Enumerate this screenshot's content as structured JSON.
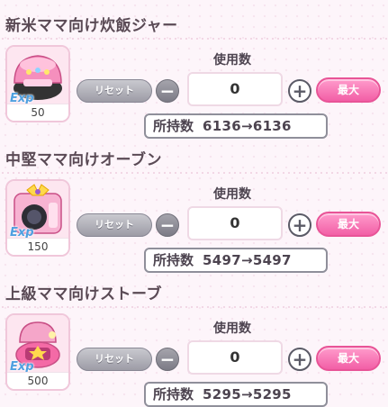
{
  "colors": {
    "accent_pink": "#f25fa6",
    "reset_gray": "#9d9ca6",
    "exp_blue": "#4fa0e0",
    "card_border": "#f0c7da"
  },
  "items": [
    {
      "title": "新米ママ向け炊飯ジャー",
      "icon": "rice-cooker-icon",
      "exp_label": "Exp",
      "exp_value": "50",
      "reset_label": "リセット",
      "use_label": "使用数",
      "quantity": "0",
      "max_label": "最大",
      "owned_label": "所持数",
      "owned_value": "6136→6136"
    },
    {
      "title": "中堅ママ向けオーブン",
      "icon": "oven-icon",
      "exp_label": "Exp",
      "exp_value": "150",
      "reset_label": "リセット",
      "use_label": "使用数",
      "quantity": "0",
      "max_label": "最大",
      "owned_label": "所持数",
      "owned_value": "5497→5497"
    },
    {
      "title": "上級ママ向けストーブ",
      "icon": "stove-icon",
      "exp_label": "Exp",
      "exp_value": "500",
      "reset_label": "リセット",
      "use_label": "使用数",
      "quantity": "0",
      "max_label": "最大",
      "owned_label": "所持数",
      "owned_value": "5295→5295"
    }
  ]
}
